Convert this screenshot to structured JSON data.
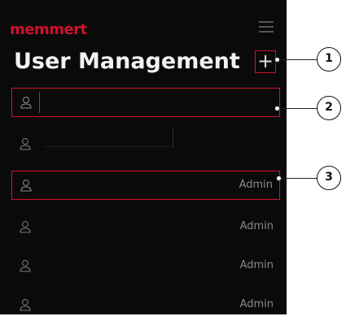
{
  "brand": {
    "logo_text": "memmert"
  },
  "header": {
    "title": "User Management",
    "add_button_label": "+"
  },
  "users": [
    {
      "role": ""
    },
    {
      "role": ""
    },
    {
      "role": "Admin"
    },
    {
      "role": "Admin"
    },
    {
      "role": "Admin"
    },
    {
      "role": "Admin"
    }
  ],
  "callouts": [
    "1",
    "2",
    "3"
  ],
  "colors": {
    "accent": "#d0122c",
    "background": "#0a0a0a",
    "text": "#f2f2f2",
    "muted": "#8a8a8a"
  },
  "icons": {
    "menu": "hamburger-icon",
    "user": "user-icon",
    "add": "plus-icon"
  }
}
